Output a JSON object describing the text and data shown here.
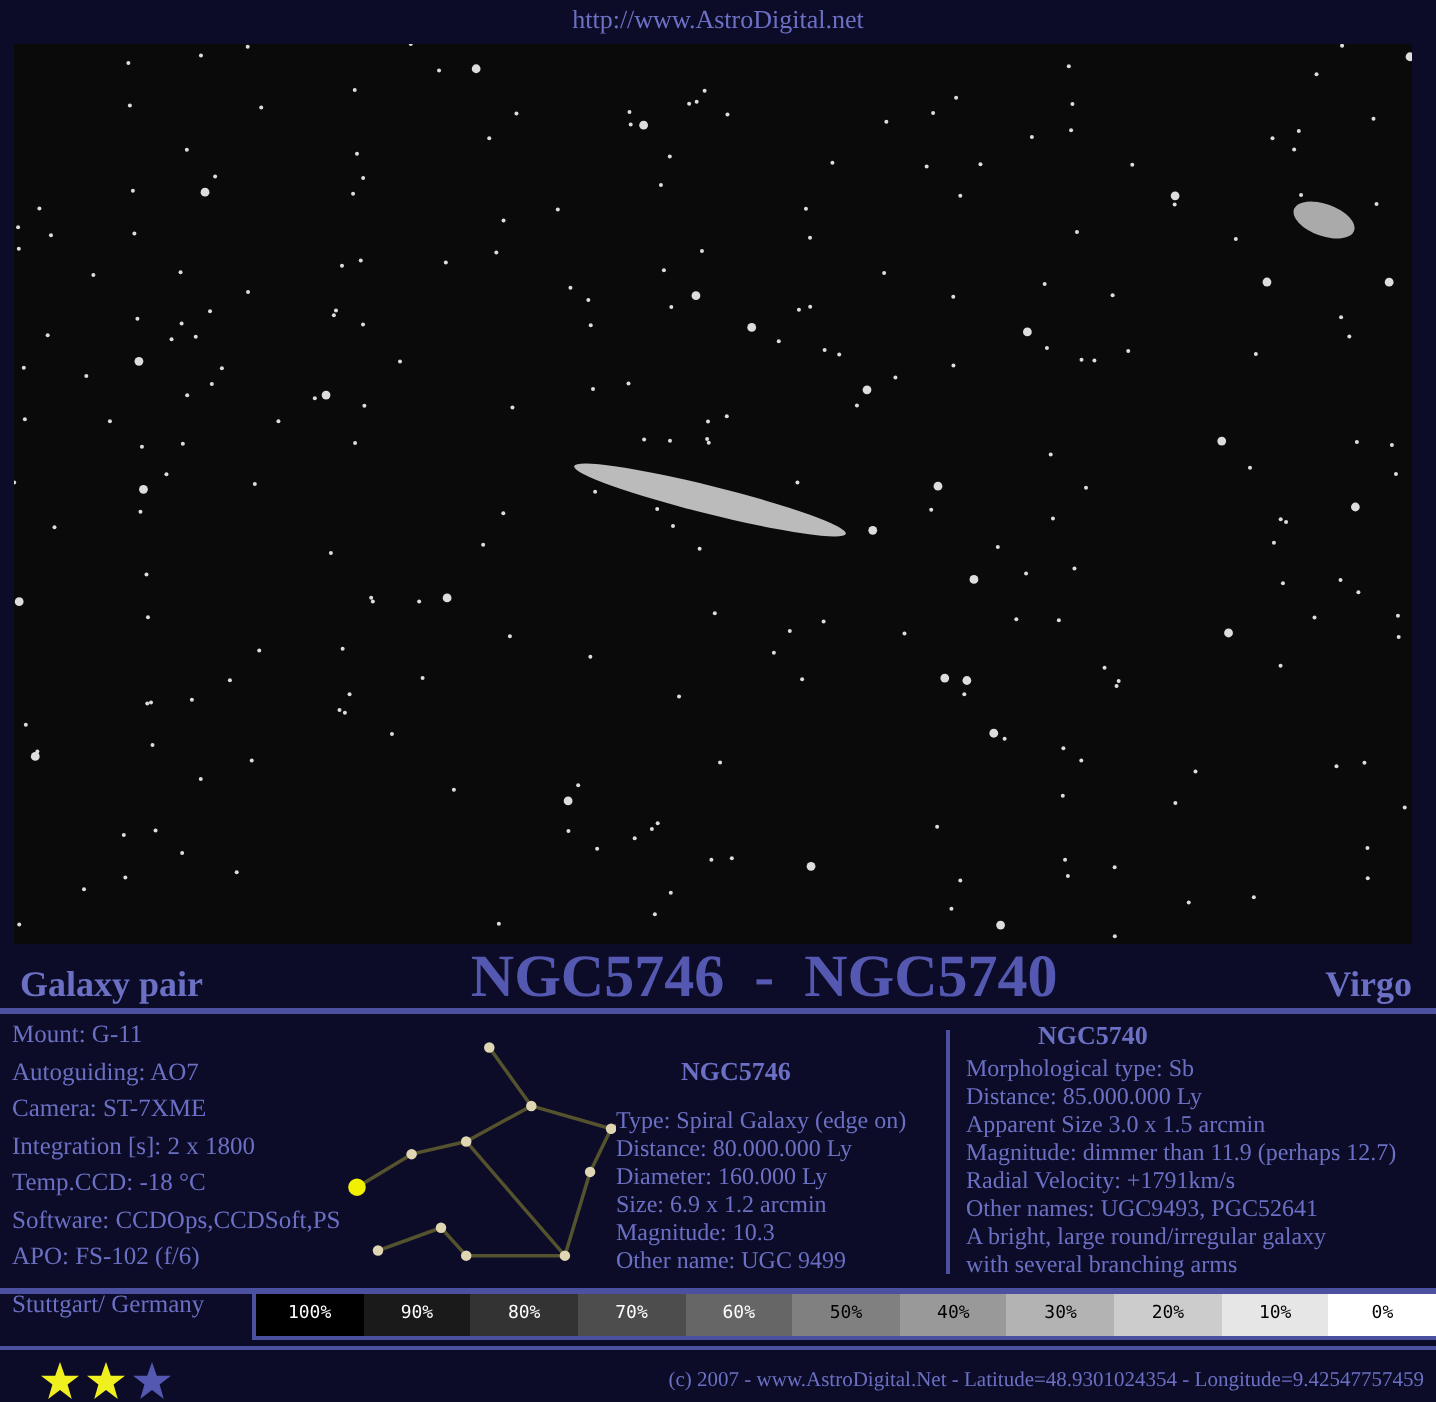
{
  "header": {
    "url": "http://www.AstroDigital.net"
  },
  "title_bar": {
    "left": "Galaxy pair",
    "title": "NGC5746  -  NGC5740",
    "right": "Virgo"
  },
  "equipment": [
    "Mount: G-11",
    "Autoguiding: AO7",
    "Camera: ST-7XME",
    "Integration [s]: 2 x 1800",
    "Temp.CCD:  -18 °C",
    "Software: CCDOps,CCDSoft,PS",
    "APO: FS-102 (f/6)",
    "Stuttgart/ Germany"
  ],
  "galaxy_1": {
    "name": "NGC5746",
    "lines": [
      "Type: Spiral Galaxy (edge on)",
      "Distance: 80.000.000 Ly",
      "Diameter: 160.000 Ly",
      "Size: 6.9 x 1.2 arcmin",
      "Magnitude: 10.3",
      "Other name: UGC 9499"
    ]
  },
  "galaxy_2": {
    "name": "NGC5740",
    "lines": [
      "Morphological type: Sb",
      "Distance: 85.000.000 Ly",
      "Apparent Size  3.0 x 1.5 arcmin",
      "Magnitude: dimmer than 11.9 (perhaps  12.7)",
      "Radial Velocity: +1791km/s",
      "Other names: UGC9493, PGC52641",
      "A bright, large round/irregular galaxy",
      "with several branching arms"
    ]
  },
  "grayscale": [
    {
      "label": "100%",
      "color": "#000000"
    },
    {
      "label": "90%",
      "color": "#1a1a1a"
    },
    {
      "label": "80%",
      "color": "#333333"
    },
    {
      "label": "70%",
      "color": "#4d4d4d"
    },
    {
      "label": "60%",
      "color": "#666666"
    },
    {
      "label": "50%",
      "color": "#808080"
    },
    {
      "label": "40%",
      "color": "#999999"
    },
    {
      "label": "30%",
      "color": "#b3b3b3"
    },
    {
      "label": "20%",
      "color": "#cccccc"
    },
    {
      "label": "10%",
      "color": "#e6e6e6"
    },
    {
      "label": "0%",
      "color": "#ffffff"
    }
  ],
  "rating": {
    "stars": 2
  },
  "footer": "(c) 2007  -  www.AstroDigital.Net - Latitude=48.9301024354 - Longitude=9.42547757459"
}
